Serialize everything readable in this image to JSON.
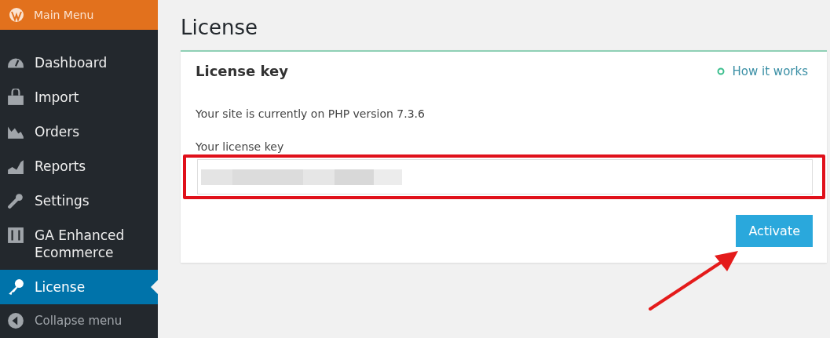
{
  "sidebar": {
    "header": "Main Menu",
    "items": [
      {
        "label": "Dashboard",
        "selected": false
      },
      {
        "label": "Import",
        "selected": false
      },
      {
        "label": "Orders",
        "selected": false
      },
      {
        "label": "Reports",
        "selected": false
      },
      {
        "label": "Settings",
        "selected": false
      },
      {
        "label": "GA Enhanced Ecommerce",
        "selected": false
      },
      {
        "label": "License",
        "selected": true
      }
    ],
    "collapse": "Collapse menu"
  },
  "page": {
    "title": "License"
  },
  "card": {
    "title": "License key",
    "help_link": "How it works",
    "php_notice": "Your site is currently on PHP version 7.3.6",
    "field_label": "Your license key",
    "highlighted": true,
    "button": "Activate"
  }
}
